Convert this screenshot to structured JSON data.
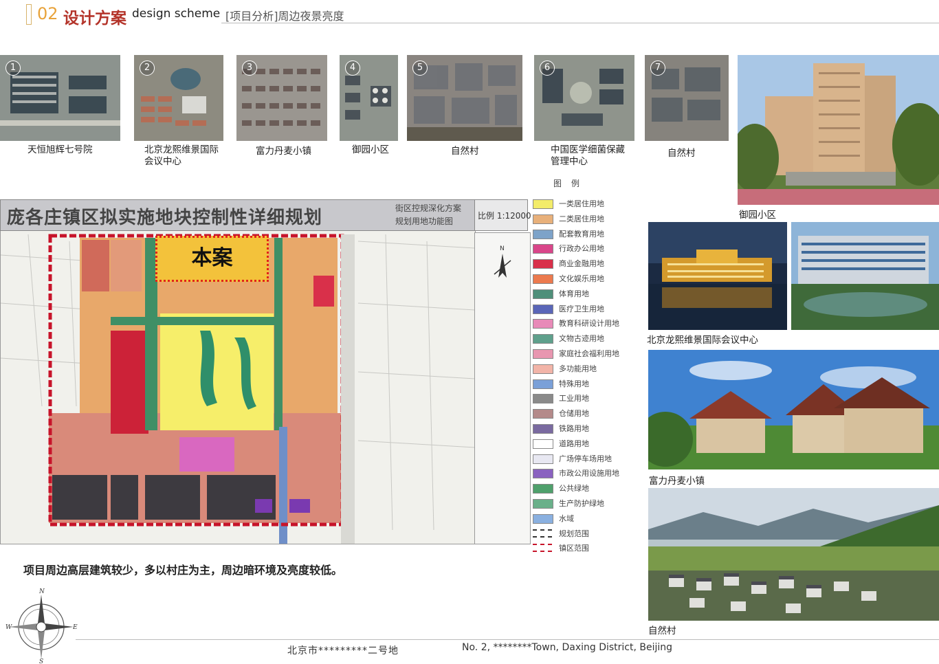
{
  "header": {
    "number": "02",
    "title_cn": "设计方案",
    "title_en": "design scheme",
    "subtitle": "[项目分析]周边夜景亮度"
  },
  "aerials": [
    {
      "num": "1",
      "caption": "天恒旭辉七号院"
    },
    {
      "num": "2",
      "caption": "北京龙熙维景国际会议中心"
    },
    {
      "num": "3",
      "caption": "富力丹麦小镇"
    },
    {
      "num": "4",
      "caption": "御园小区"
    },
    {
      "num": "5",
      "caption": "自然村"
    },
    {
      "num": "6",
      "caption": "中国医学细菌保藏管理中心"
    },
    {
      "num": "7",
      "caption": "自然村"
    }
  ],
  "photos": [
    {
      "caption": "御园小区"
    },
    {
      "caption": "北京龙熙维景国际会议中心"
    },
    {
      "caption": "富力丹麦小镇"
    },
    {
      "caption": "自然村"
    }
  ],
  "map": {
    "title": "庞各庄镇区拟实施地块控制性详细规划",
    "sub_line1": "街区控规深化方案",
    "sub_line2": "规划用地功能图",
    "scale": "比例 1:12000",
    "site_label": "本案"
  },
  "legend": {
    "title": "图例",
    "items": [
      {
        "label": "一类居住用地",
        "color": "#f3ec6a"
      },
      {
        "label": "二类居住用地",
        "color": "#e8b07a"
      },
      {
        "label": "配套教育用地",
        "color": "#7da3c9"
      },
      {
        "label": "行政办公用地",
        "color": "#d9468a"
      },
      {
        "label": "商业金融用地",
        "color": "#d9304a"
      },
      {
        "label": "文化娱乐用地",
        "color": "#ec7a4e"
      },
      {
        "label": "体育用地",
        "color": "#4f8f7a"
      },
      {
        "label": "医疗卫生用地",
        "color": "#5a66b8"
      },
      {
        "label": "教育科研设计用地",
        "color": "#e88ab8"
      },
      {
        "label": "文物古迹用地",
        "color": "#5fa08c"
      },
      {
        "label": "家庭社会福利用地",
        "color": "#e896b0"
      },
      {
        "label": "多功能用地",
        "color": "#f2b4a8"
      },
      {
        "label": "特殊用地",
        "color": "#7aa0d8"
      },
      {
        "label": "工业用地",
        "color": "#8a8a8a"
      },
      {
        "label": "仓储用地",
        "color": "#b48a8a"
      },
      {
        "label": "铁路用地",
        "color": "#7a6aa0"
      },
      {
        "label": "道路用地",
        "color": "#ffffff"
      },
      {
        "label": "广场停车场用地",
        "color": "#e8e8f2"
      },
      {
        "label": "市政公用设施用地",
        "color": "#8a62c0"
      },
      {
        "label": "公共绿地",
        "color": "#4fa06c"
      },
      {
        "label": "生产防护绿地",
        "color": "#6ab08a"
      },
      {
        "label": "水域",
        "color": "#8ab0e0"
      },
      {
        "label": "规划范围",
        "color": "#ffffff"
      },
      {
        "label": "镇区范围",
        "color": "#ffffff"
      }
    ]
  },
  "note": "项目周边高层建筑较少，多以村庄为主，周边暗环境及亮度较低。",
  "footer": {
    "cn": "北京市*********二号地",
    "en": "No. 2, ********Town, Daxing District, Beijing"
  },
  "colors": {
    "accent_orange": "#e8a33b",
    "accent_red": "#b4342a",
    "site_red": "#e2231a"
  }
}
